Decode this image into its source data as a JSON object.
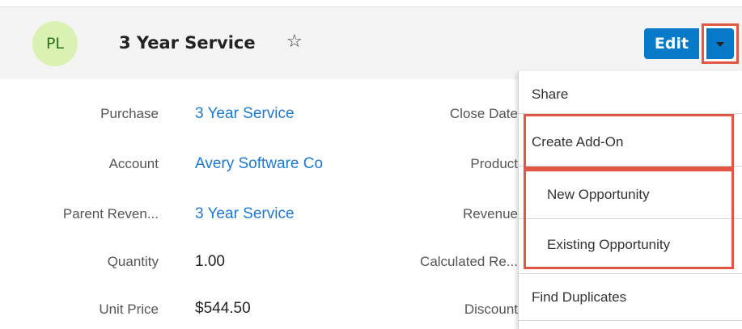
{
  "header": {
    "avatar_initials": "PL",
    "title": "3 Year Service",
    "star_icon": "☆",
    "edit_label": "Edit"
  },
  "fields": [
    {
      "label": "Purchase",
      "value": "3 Year Service",
      "type": "link"
    },
    {
      "label": "Account",
      "value": "Avery Software Co",
      "type": "link"
    },
    {
      "label": "Parent Reven...",
      "value": "3 Year Service",
      "type": "link"
    },
    {
      "label": "Quantity",
      "value": "1.00",
      "type": "plain"
    },
    {
      "label": "Unit Price",
      "value": "$544.50",
      "type": "plain"
    }
  ],
  "right_labels": [
    "Close Date",
    "Product",
    "Revenue",
    "Calculated Re...",
    "Discount"
  ],
  "menu": {
    "share": "Share",
    "create_addon": "Create Add-On",
    "new_opportunity": "New Opportunity",
    "existing_opportunity": "Existing Opportunity",
    "find_duplicates": "Find Duplicates"
  },
  "colors": {
    "accent": "#0679c8",
    "link": "#1a7ad6",
    "highlight": "#e25744",
    "avatar_bg": "#d9f2b4"
  }
}
